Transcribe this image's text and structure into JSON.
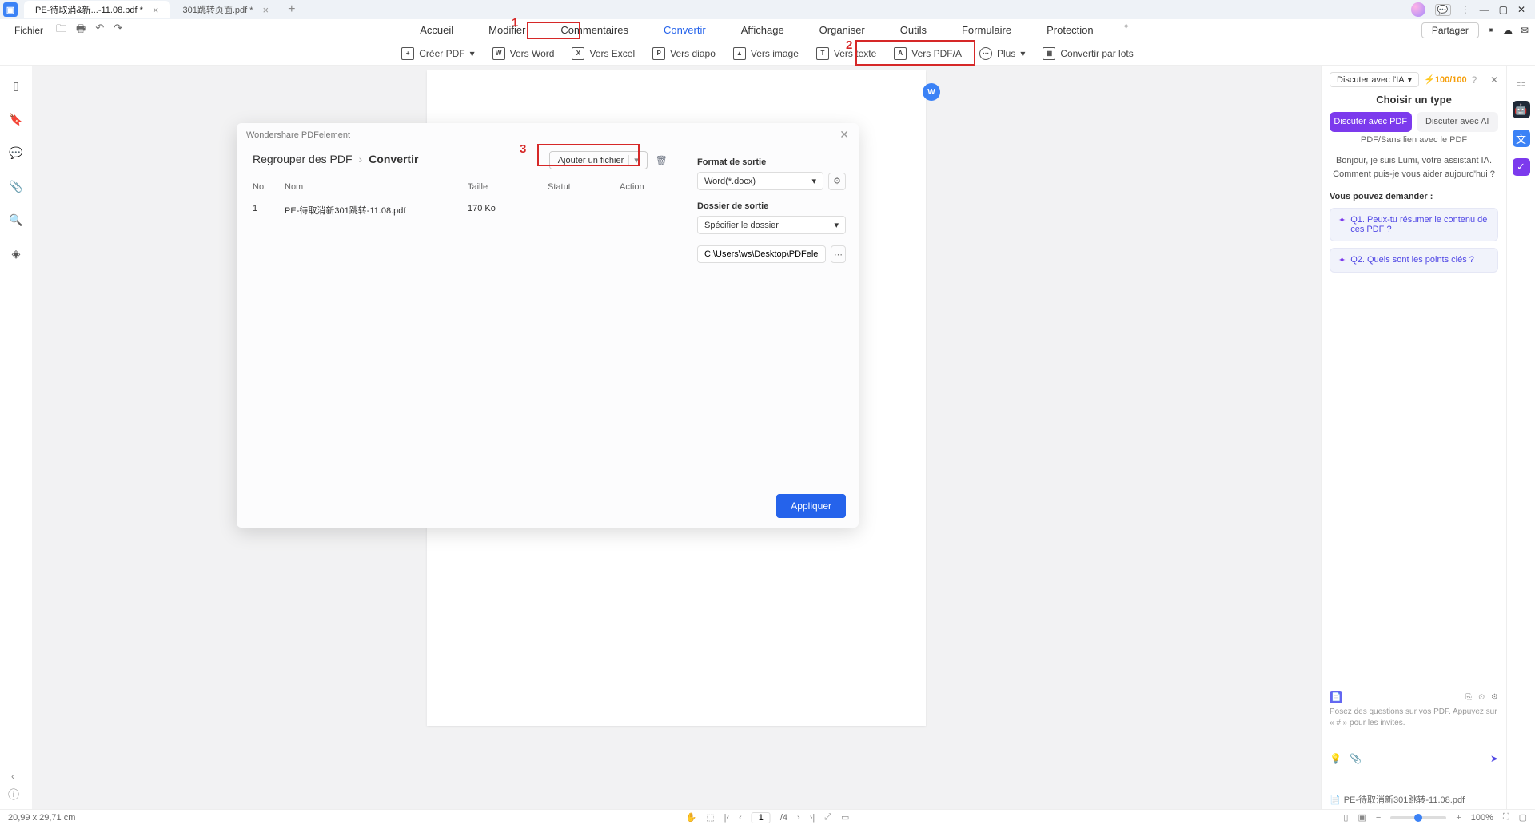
{
  "title_bar": {
    "tabs": [
      {
        "label": "PE-待取消&新...-11.08.pdf *",
        "active": true
      },
      {
        "label": "301跳转页面.pdf *",
        "active": false
      }
    ]
  },
  "menu": {
    "file": "Fichier",
    "items": [
      "Accueil",
      "Modifier",
      "Commentaires",
      "Convertir",
      "Affichage",
      "Organiser",
      "Outils",
      "Formulaire",
      "Protection"
    ],
    "active_index": 3,
    "share": "Partager"
  },
  "toolbar": {
    "create": "Créer PDF",
    "word": "Vers Word",
    "excel": "Vers Excel",
    "diapo": "Vers diapo",
    "image": "Vers image",
    "texte": "Vers texte",
    "pdfa": "Vers PDF/A",
    "plus": "Plus",
    "batch": "Convertir par lots"
  },
  "annotations": {
    "n1": "1",
    "n2": "2",
    "n3": "3"
  },
  "dialog": {
    "title": "Wondershare PDFelement",
    "crumb_root": "Regrouper des PDF",
    "crumb_cur": "Convertir",
    "add_file": "Ajouter un fichier",
    "cols": {
      "no": "No.",
      "nom": "Nom",
      "taille": "Taille",
      "statut": "Statut",
      "action": "Action"
    },
    "rows": [
      {
        "no": "1",
        "nom": "PE-待取消新301跳转-11.08.pdf",
        "taille": "170 Ko",
        "statut": "",
        "action": ""
      }
    ],
    "format_label": "Format de sortie",
    "format_value": "Word(*.docx)",
    "dossier_label": "Dossier de sortie",
    "dossier_value": "Spécifier le dossier",
    "path_value": "C:\\Users\\ws\\Desktop\\PDFelement\\Con",
    "apply": "Appliquer"
  },
  "right_panel": {
    "discuss": "Discuter avec l'IA",
    "credits": "100/100",
    "title": "Choisir un type",
    "tab_pdf": "Discuter avec PDF",
    "tab_ai": "Discuter avec AI",
    "sub": "PDF/Sans lien avec le PDF",
    "greeting": "Bonjour, je suis Lumi, votre assistant IA. Comment puis-je vous aider aujourd'hui ?",
    "hint": "Vous pouvez demander :",
    "q1": "Q1. Peux-tu résumer le contenu de ces PDF ?",
    "q2": "Q2. Quels sont les points clés ?",
    "prompt": "Posez des questions sur vos PDF. Appuyez sur « # » pour les invites.",
    "file": "PE-待取消新301跳转-11.08.pdf"
  },
  "status": {
    "dims": "20,99 x 29,71 cm",
    "page": "1",
    "total": "/4",
    "zoom": "100%"
  }
}
